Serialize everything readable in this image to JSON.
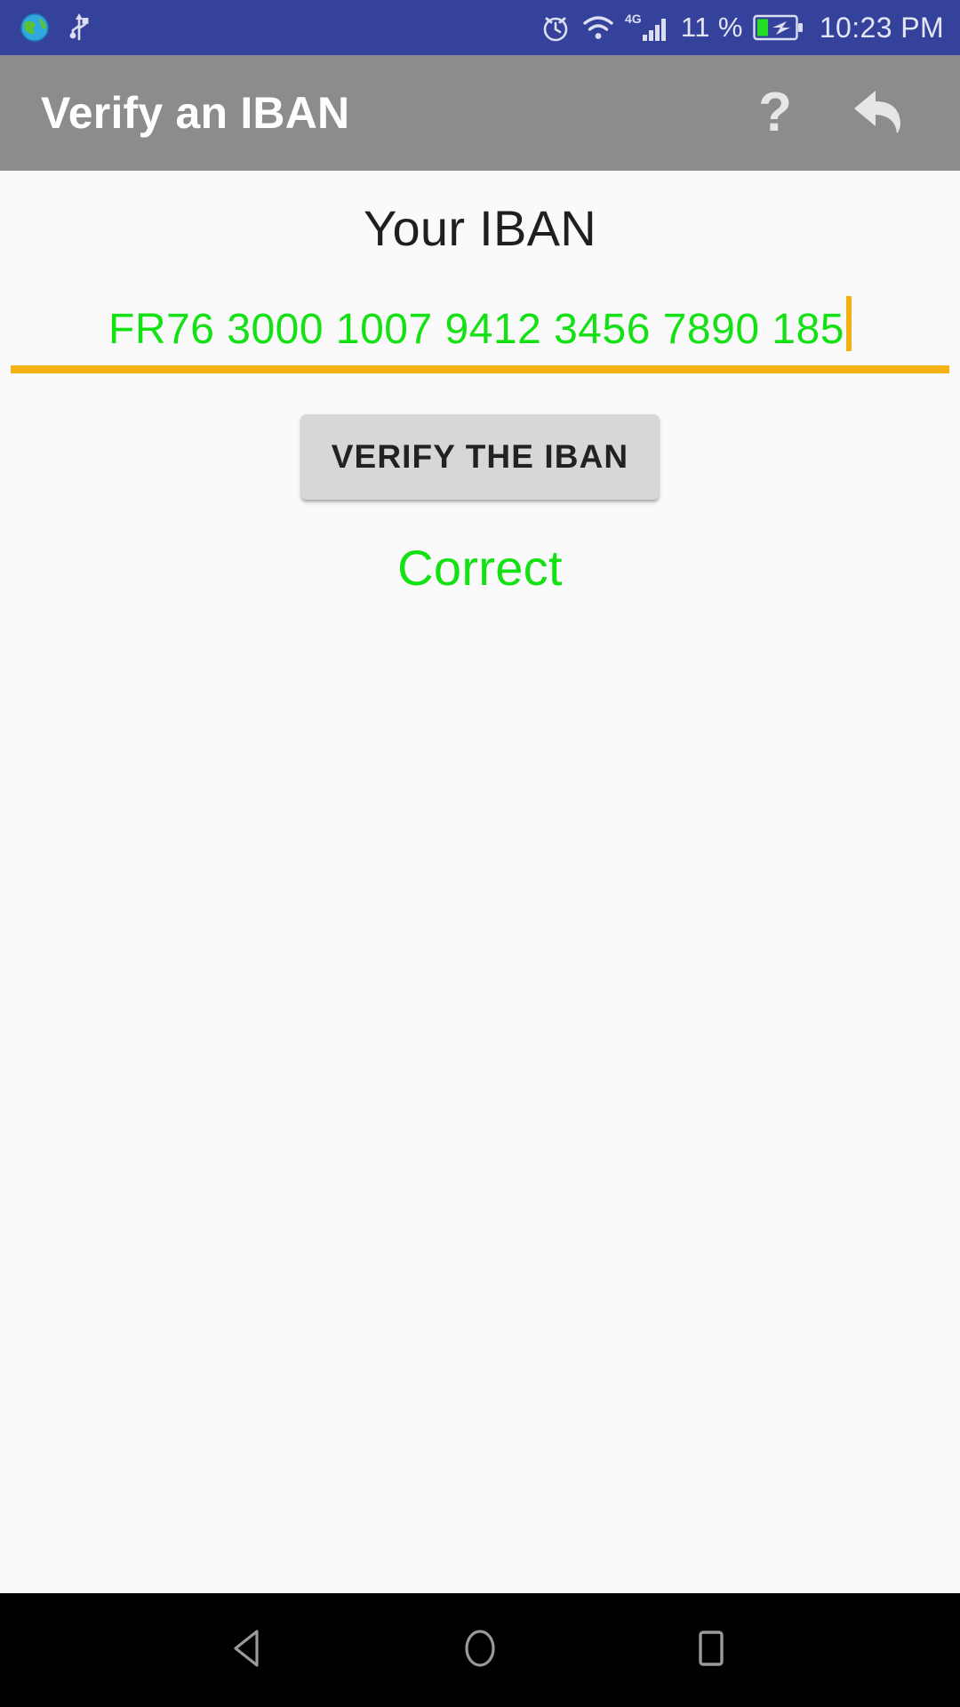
{
  "status_bar": {
    "background_color": "#35429b",
    "left_icons": [
      {
        "name": "globe-icon",
        "label": "globe"
      },
      {
        "name": "usb-icon",
        "label": "usb"
      }
    ],
    "right_icons": [
      {
        "name": "alarm-icon",
        "label": "alarm"
      },
      {
        "name": "wifi-icon",
        "label": "wifi"
      },
      {
        "name": "mobile-signal-icon",
        "label": "4G"
      }
    ],
    "network_type": "4G",
    "battery_percent": "11 %",
    "battery_state": "charging",
    "time": "10:23 PM"
  },
  "app_bar": {
    "title": "Verify an IBAN",
    "background_color": "#8c8c8e",
    "help_label": "?",
    "help_icon": "question-mark-icon",
    "back_icon": "reply-back-arrow-icon"
  },
  "main": {
    "iban_label": "Your IBAN",
    "iban_value": "FR76 3000 1007 9412 3456 7890 185",
    "iban_placeholder": "Your IBAN",
    "iban_text_color": "#14e114",
    "underline_color": "#f5b111",
    "caret_color": "#f5b111",
    "verify_button_label": "VERIFY THE IBAN",
    "result_text": "Correct",
    "result_color": "#14e114"
  },
  "nav_bar": {
    "background_color": "#000000",
    "buttons": [
      {
        "name": "nav-back-icon",
        "label": "Back"
      },
      {
        "name": "nav-home-icon",
        "label": "Home"
      },
      {
        "name": "nav-recents-icon",
        "label": "Recents"
      }
    ]
  }
}
